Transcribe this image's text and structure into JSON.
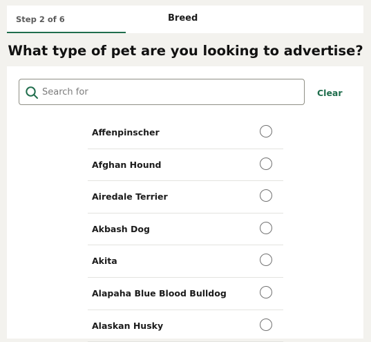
{
  "stepper": {
    "step_label": "Step 2 of 6",
    "title": "Breed",
    "progress_fraction": 0.333
  },
  "question": "What type of pet are you looking to advertise?",
  "search": {
    "value": "",
    "placeholder": "Search for",
    "clear_label": "Clear",
    "icon": "search-icon"
  },
  "breeds": [
    "Affenpinscher",
    "Afghan Hound",
    "Airedale Terrier",
    "Akbash Dog",
    "Akita",
    "Alapaha Blue Blood Bulldog",
    "Alaskan Husky"
  ],
  "colors": {
    "accent": "#1f6d4c",
    "page_bg": "#f3f2ee",
    "panel_bg": "#ffffff"
  }
}
